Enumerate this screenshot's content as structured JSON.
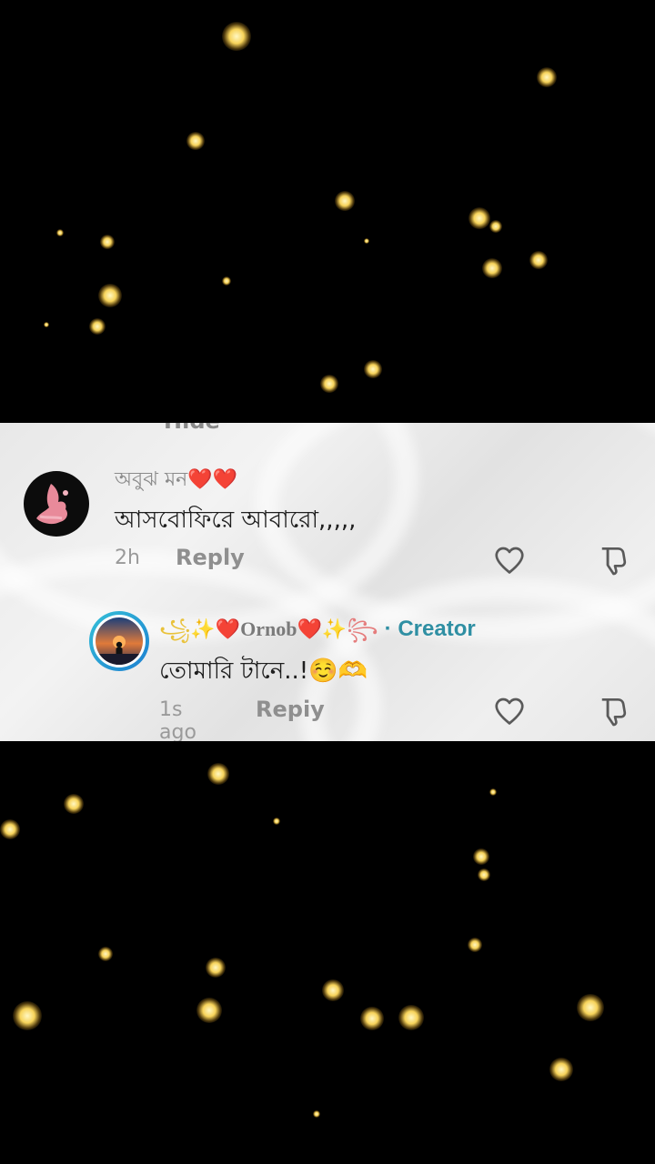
{
  "clipped_text": "Hide",
  "comments": [
    {
      "username": "অবুঝ মন",
      "username_suffix": "❤️❤️",
      "text": "আসবোফিরে আবারো,,,,,",
      "time": "2h",
      "reply_label": "Reply"
    },
    {
      "username_prefix": "꧁✨❤️",
      "username": "Ornob",
      "username_suffix": "❤️✨꧂",
      "creator_label": "· Creator",
      "text": "তোমারি টানে..!☺️🫶",
      "time": "1s ago",
      "reply_label": "Repiy"
    }
  ],
  "icons": [
    "heart-outline-icon",
    "dislike-icon"
  ],
  "colors": {
    "panel_bg": "#ebebeb",
    "creator_accent": "#2f8fa3",
    "meta_gray": "#9a9a9a",
    "firefly": "#f7d35a"
  }
}
